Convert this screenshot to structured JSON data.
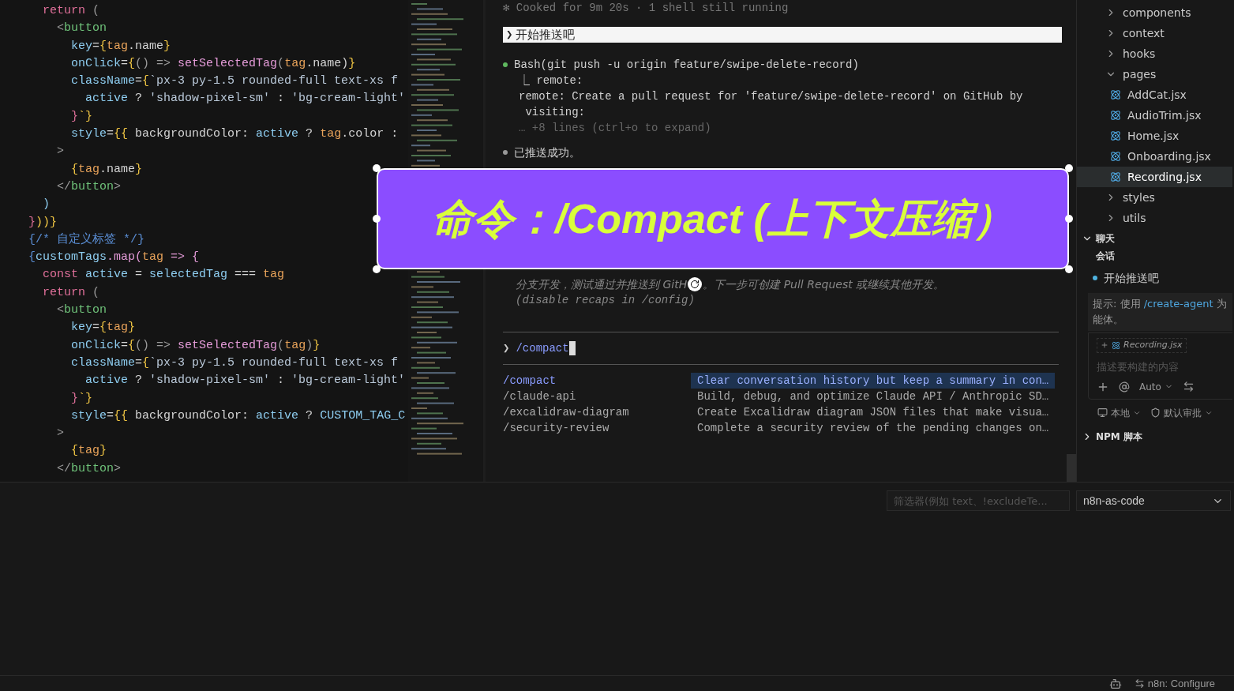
{
  "editor": {
    "lines": [
      [
        {
          "t": "    return ",
          "kind": "kw"
        },
        {
          "t": "(",
          "kind": "br"
        }
      ],
      [
        {
          "t": "      <",
          "kind": "br"
        },
        {
          "t": "button",
          "kind": "tag"
        }
      ],
      [
        {
          "t": "        key",
          "kind": "attr"
        },
        {
          "t": "=",
          "kind": "pl"
        },
        {
          "t": "{",
          "kind": "pu"
        },
        {
          "t": "tag",
          "kind": "var"
        },
        {
          "t": ".name",
          "kind": "pl"
        },
        {
          "t": "}",
          "kind": "pu"
        }
      ],
      [
        {
          "t": "        onClick",
          "kind": "attr"
        },
        {
          "t": "=",
          "kind": "pl"
        },
        {
          "t": "{",
          "kind": "pu"
        },
        {
          "t": "() => ",
          "kind": "br"
        },
        {
          "t": "setSelectedTag",
          "kind": "fn"
        },
        {
          "t": "(",
          "kind": "br"
        },
        {
          "t": "tag",
          "kind": "var"
        },
        {
          "t": ".name)",
          "kind": "pl"
        },
        {
          "t": "}",
          "kind": "pu"
        }
      ],
      [
        {
          "t": "        className",
          "kind": "attr"
        },
        {
          "t": "=",
          "kind": "pl"
        },
        {
          "t": "{",
          "kind": "pu"
        },
        {
          "t": "`px-3 py-1.5 rounded-full text-xs f",
          "kind": "str"
        }
      ],
      [
        {
          "t": "          active",
          "kind": "attr"
        },
        {
          "t": " ? ",
          "kind": "pl"
        },
        {
          "t": "'shadow-pixel-sm'",
          "kind": "str"
        },
        {
          "t": " : ",
          "kind": "pl"
        },
        {
          "t": "'bg-cream-light'",
          "kind": "str"
        }
      ],
      [
        {
          "t": "        }",
          "kind": "kw"
        },
        {
          "t": "`}",
          "kind": "pu"
        }
      ],
      [
        {
          "t": "        style",
          "kind": "attr"
        },
        {
          "t": "=",
          "kind": "pl"
        },
        {
          "t": "{{ ",
          "kind": "pu"
        },
        {
          "t": "backgroundColor: ",
          "kind": "pl"
        },
        {
          "t": "active",
          "kind": "attr"
        },
        {
          "t": " ? ",
          "kind": "pl"
        },
        {
          "t": "tag",
          "kind": "var"
        },
        {
          "t": ".color :",
          "kind": "pl"
        }
      ],
      [
        {
          "t": "      >",
          "kind": "br"
        }
      ],
      [
        {
          "t": "        {",
          "kind": "pu"
        },
        {
          "t": "tag",
          "kind": "var"
        },
        {
          "t": ".name",
          "kind": "pl"
        },
        {
          "t": "}",
          "kind": "pu"
        }
      ],
      [
        {
          "t": "      </",
          "kind": "br"
        },
        {
          "t": "button",
          "kind": "tag"
        },
        {
          "t": ">",
          "kind": "br"
        }
      ],
      [
        {
          "t": "    )",
          "kind": "attr"
        }
      ],
      [
        {
          "t": "  }",
          "kind": "kw"
        },
        {
          "t": "))}",
          "kind": "pu"
        }
      ],
      [
        {
          "t": "  {/* 自定义标签 */}",
          "kind": "cm"
        }
      ],
      [
        {
          "t": "  {",
          "kind": "cm"
        },
        {
          "t": "customTags",
          "kind": "attr"
        },
        {
          "t": ".map(",
          "kind": "fn"
        },
        {
          "t": "tag",
          "kind": "var"
        },
        {
          "t": " => {",
          "kind": "fn"
        }
      ],
      [
        {
          "t": "    const ",
          "kind": "kw"
        },
        {
          "t": "active",
          "kind": "attr"
        },
        {
          "t": " = ",
          "kind": "pl"
        },
        {
          "t": "selectedTag",
          "kind": "attr"
        },
        {
          "t": " === ",
          "kind": "pl"
        },
        {
          "t": "tag",
          "kind": "var"
        }
      ],
      [
        {
          "t": "    return ",
          "kind": "kw"
        },
        {
          "t": "(",
          "kind": "br"
        }
      ],
      [
        {
          "t": "      <",
          "kind": "br"
        },
        {
          "t": "button",
          "kind": "tag"
        }
      ],
      [
        {
          "t": "        key",
          "kind": "attr"
        },
        {
          "t": "=",
          "kind": "pl"
        },
        {
          "t": "{",
          "kind": "pu"
        },
        {
          "t": "tag",
          "kind": "var"
        },
        {
          "t": "}",
          "kind": "pu"
        }
      ],
      [
        {
          "t": "        onClick",
          "kind": "attr"
        },
        {
          "t": "=",
          "kind": "pl"
        },
        {
          "t": "{",
          "kind": "pu"
        },
        {
          "t": "() => ",
          "kind": "br"
        },
        {
          "t": "setSelectedTag",
          "kind": "fn"
        },
        {
          "t": "(",
          "kind": "br"
        },
        {
          "t": "tag",
          "kind": "var"
        },
        {
          "t": ")",
          "kind": "br"
        },
        {
          "t": "}",
          "kind": "pu"
        }
      ],
      [
        {
          "t": "        className",
          "kind": "attr"
        },
        {
          "t": "=",
          "kind": "pl"
        },
        {
          "t": "{",
          "kind": "pu"
        },
        {
          "t": "`px-3 py-1.5 rounded-full text-xs f",
          "kind": "str"
        }
      ],
      [
        {
          "t": "          active",
          "kind": "attr"
        },
        {
          "t": " ? ",
          "kind": "pl"
        },
        {
          "t": "'shadow-pixel-sm'",
          "kind": "str"
        },
        {
          "t": " : ",
          "kind": "pl"
        },
        {
          "t": "'bg-cream-light'",
          "kind": "str"
        }
      ],
      [
        {
          "t": "        }",
          "kind": "kw"
        },
        {
          "t": "`}",
          "kind": "pu"
        }
      ],
      [
        {
          "t": "        style",
          "kind": "attr"
        },
        {
          "t": "=",
          "kind": "pl"
        },
        {
          "t": "{{ ",
          "kind": "pu"
        },
        {
          "t": "backgroundColor: ",
          "kind": "pl"
        },
        {
          "t": "active",
          "kind": "attr"
        },
        {
          "t": " ? ",
          "kind": "pl"
        },
        {
          "t": "CUSTOM_TAG_C",
          "kind": "attr"
        }
      ],
      [
        {
          "t": "      >",
          "kind": "br"
        }
      ],
      [
        {
          "t": "        {",
          "kind": "pu"
        },
        {
          "t": "tag",
          "kind": "var"
        },
        {
          "t": "}",
          "kind": "pu"
        }
      ],
      [
        {
          "t": "      </",
          "kind": "br"
        },
        {
          "t": "button",
          "kind": "tag"
        },
        {
          "t": ">",
          "kind": "br"
        }
      ]
    ]
  },
  "terminal": {
    "status": "✻ Cooked for 9m 20s · 1 shell still running",
    "user_message": {
      "prompt": "❯",
      "text": "开始推送吧"
    },
    "tool_call": "Bash(git push -u origin feature/swipe-delete-record)",
    "tool_output": [
      "⎿ remote:",
      "remote: Create a pull request for 'feature/swipe-delete-record' on GitHub by",
      " visiting:"
    ],
    "more_lines": "… +8 lines (ctrl+o to expand)",
    "reply": "已推送成功。",
    "recap": [
      "分支开发，测试通过并推送到 GitH",
      "。下一步可创建 Pull Request 或继续其他开发。",
      "(disable recaps in /config)"
    ],
    "input": {
      "prompt": "❯",
      "value": "/compact"
    },
    "suggestions": [
      {
        "command": "/compact",
        "description": "Clear conversation history but keep a summary in con…",
        "selected": true
      },
      {
        "command": "/claude-api",
        "description": "Build, debug, and optimize Claude API / Anthropic SD…",
        "selected": false
      },
      {
        "command": "/excalidraw-diagram",
        "description": "Create Excalidraw diagram JSON files that make visua…",
        "selected": false
      },
      {
        "command": "/security-review",
        "description": "Complete a security review of the pending changes on…",
        "selected": false
      }
    ]
  },
  "caption": {
    "text": "命令：/Compact (上下文压缩）"
  },
  "explorer": {
    "items": [
      {
        "label": "components",
        "kind": "folder",
        "expanded": false,
        "selected": false
      },
      {
        "label": "context",
        "kind": "folder",
        "expanded": false,
        "selected": false
      },
      {
        "label": "hooks",
        "kind": "folder",
        "expanded": false,
        "selected": false
      },
      {
        "label": "pages",
        "kind": "folder",
        "expanded": true,
        "selected": false,
        "children": [
          {
            "label": "AddCat.jsx",
            "kind": "file",
            "selected": false
          },
          {
            "label": "AudioTrim.jsx",
            "kind": "file",
            "selected": false
          },
          {
            "label": "Home.jsx",
            "kind": "file",
            "selected": false
          },
          {
            "label": "Onboarding.jsx",
            "kind": "file",
            "selected": false
          },
          {
            "label": "Recording.jsx",
            "kind": "file",
            "selected": true
          }
        ]
      },
      {
        "label": "styles",
        "kind": "folder",
        "expanded": false,
        "selected": false
      },
      {
        "label": "utils",
        "kind": "folder",
        "expanded": false,
        "selected": false
      }
    ]
  },
  "chat": {
    "title": "聊天",
    "expanded": true,
    "sessions_label": "会话",
    "sessions": [
      {
        "label": "开始推送吧"
      }
    ],
    "hint": {
      "prefix": "提示: 使用",
      "link": "/create-agent",
      "suffix": "为",
      "line2": "能体。"
    },
    "attachment": "Recording.jsx",
    "placeholder": "描述要构建的内容",
    "mode": "Auto",
    "location": "本地",
    "approval": "默认审批"
  },
  "npm": {
    "title": "NPM 脚本",
    "expanded": false
  },
  "panel": {
    "filter_placeholder": "筛选器(例如 text、!excludeTe...",
    "select": "n8n-as-code"
  },
  "status_bar": {
    "item": "n8n: Configure"
  }
}
